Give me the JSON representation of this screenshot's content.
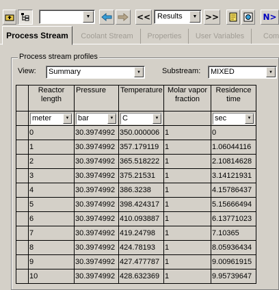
{
  "toolbar": {
    "combo_blank": "",
    "back_label": "<<",
    "results_value": "Results",
    "forward_label": ">>",
    "next_label": "N>"
  },
  "tabs": [
    {
      "label": "Process Stream"
    },
    {
      "label": "Coolant Stream"
    },
    {
      "label": "Properties"
    },
    {
      "label": "User Variables"
    },
    {
      "label": "Com"
    }
  ],
  "group": {
    "title": "Process stream profiles",
    "view_label": "View:",
    "view_value": "Summary",
    "substream_label": "Substream:",
    "substream_value": "MIXED"
  },
  "table": {
    "headers": [
      "Reactor length",
      "Pressure",
      "Temperature",
      "Molar vapor fraction",
      "Residence time"
    ],
    "units": [
      "meter",
      "bar",
      "C",
      "",
      "sec"
    ],
    "rows": [
      [
        "0",
        "30.3974992",
        "350.000006",
        "1",
        "0"
      ],
      [
        "1",
        "30.3974992",
        "357.179119",
        "1",
        "1.06044116"
      ],
      [
        "2",
        "30.3974992",
        "365.518222",
        "1",
        "2.10814628"
      ],
      [
        "3",
        "30.3974992",
        "375.21531",
        "1",
        "3.14121931"
      ],
      [
        "4",
        "30.3974992",
        "386.3238",
        "1",
        "4.15786437"
      ],
      [
        "5",
        "30.3974992",
        "398.424317",
        "1",
        "5.15666494"
      ],
      [
        "6",
        "30.3974992",
        "410.093887",
        "1",
        "6.13771023"
      ],
      [
        "7",
        "30.3974992",
        "419.24798",
        "1",
        "7.10365"
      ],
      [
        "8",
        "30.3974992",
        "424.78193",
        "1",
        "8.05936434"
      ],
      [
        "9",
        "30.3974992",
        "427.477787",
        "1",
        "9.00961915"
      ],
      [
        "10",
        "30.3974992",
        "428.632369",
        "1",
        "9.95739647"
      ]
    ]
  }
}
